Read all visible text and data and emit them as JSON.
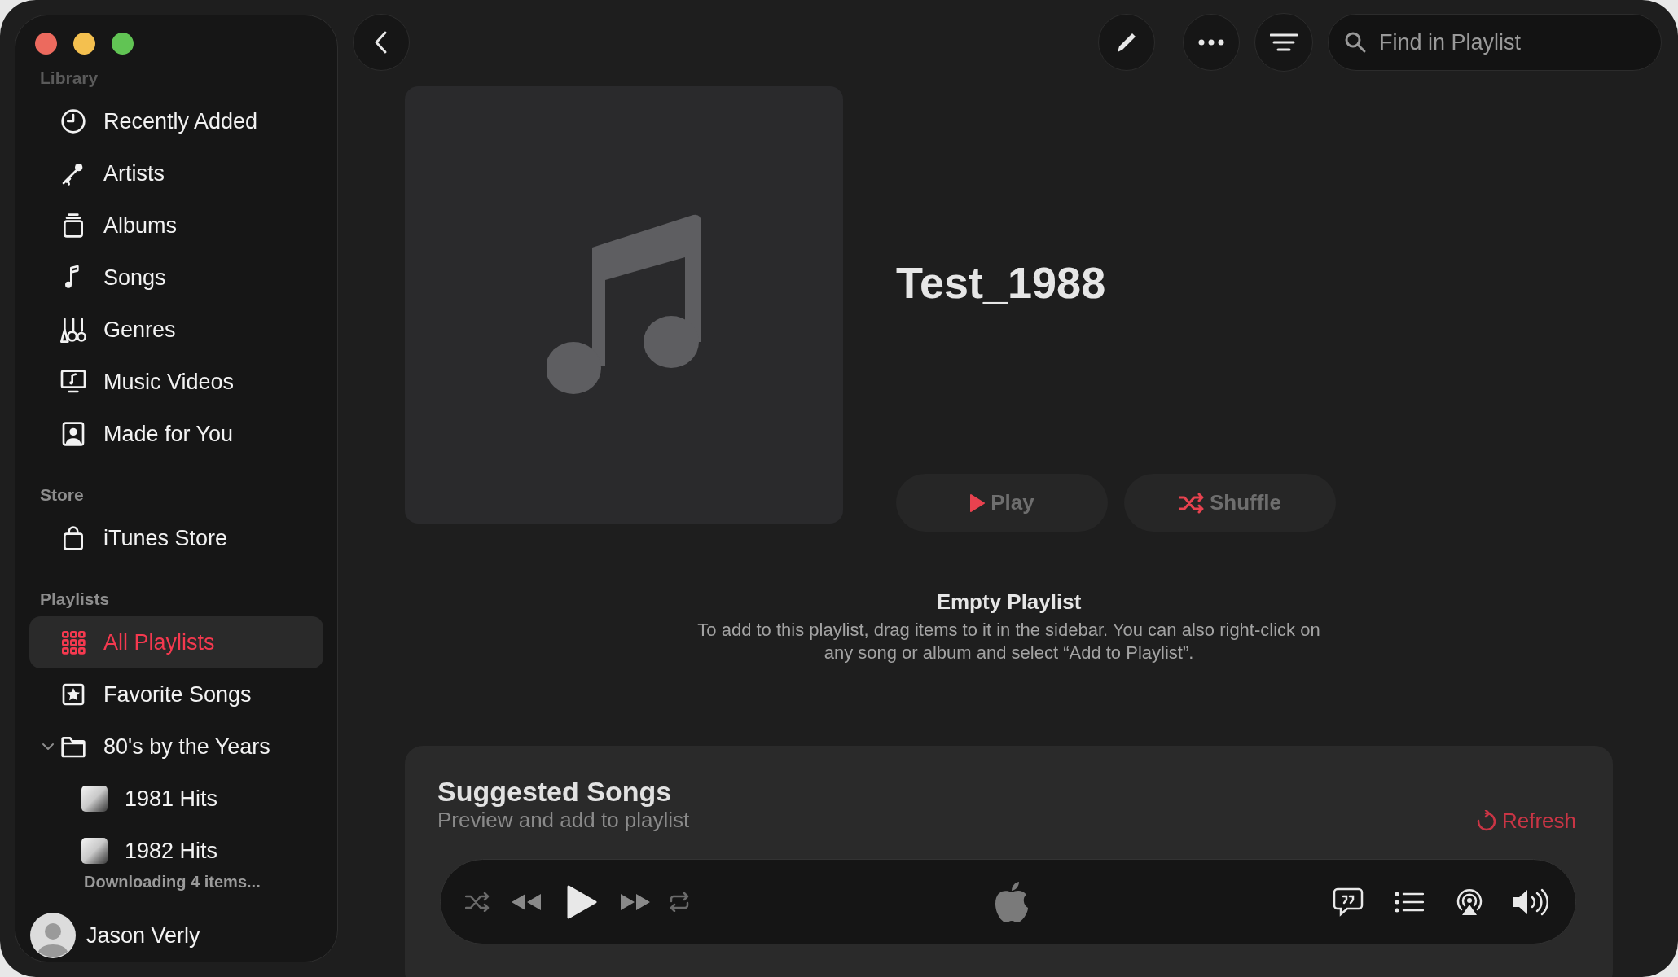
{
  "sidebar": {
    "sections": [
      {
        "title": "Library",
        "items": [
          {
            "label": "Recently Added",
            "selected": false
          },
          {
            "label": "Artists",
            "selected": false
          },
          {
            "label": "Albums",
            "selected": false
          },
          {
            "label": "Songs",
            "selected": false
          },
          {
            "label": "Genres",
            "selected": false
          },
          {
            "label": "Music Videos",
            "selected": false
          },
          {
            "label": "Made for You",
            "selected": false
          }
        ]
      },
      {
        "title": "Store",
        "items": [
          {
            "label": "iTunes Store",
            "selected": false
          }
        ]
      },
      {
        "title": "Playlists",
        "items": [
          {
            "label": "All Playlists",
            "selected": true
          },
          {
            "label": "Favorite Songs",
            "selected": false
          },
          {
            "label": "80's by the Years",
            "kind": "folder",
            "selected": false,
            "expanded": true,
            "children": [
              {
                "label": "1981 Hits",
                "selected": false
              },
              {
                "label": "1982 Hits",
                "selected": false
              }
            ]
          }
        ]
      }
    ],
    "download_status": "Downloading 4 items...",
    "user": {
      "name": "Jason Verly"
    }
  },
  "search": {
    "placeholder": "Find in Playlist"
  },
  "playlist": {
    "title": "Test_1988",
    "buttons": [
      {
        "label": "Play"
      },
      {
        "label": "Shuffle"
      }
    ]
  },
  "empty_state": {
    "title": "Empty Playlist",
    "message": "To add to this playlist, drag items to it in the sidebar. You can also right-click on any song or album and select “Add to Playlist”."
  },
  "suggested": {
    "title": "Suggested Songs",
    "subtitle": "Preview and add to playlist",
    "refresh": "Refresh"
  }
}
